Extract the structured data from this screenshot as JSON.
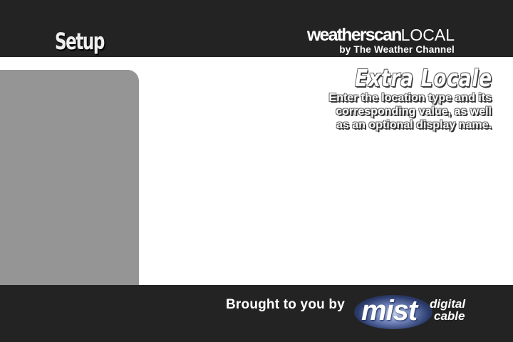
{
  "header": {
    "title": "Setup",
    "brand": {
      "name_bold": "weatherscan",
      "name_light": "LOCAL",
      "tagline": "by The Weather Channel"
    }
  },
  "content": {
    "heading": "Extra Locale",
    "description_lines": [
      "Enter the location type and its",
      "corresponding value, as well",
      "as an optional display name."
    ]
  },
  "footer": {
    "sponsor_text": "Brought to you by",
    "sponsor_logo": {
      "word": "mist",
      "line1": "digital",
      "line2": "cable"
    }
  },
  "colors": {
    "bar_background": "#232323",
    "panel_background": "#959595",
    "page_background": "#ffffff",
    "text": "#ffffff"
  }
}
